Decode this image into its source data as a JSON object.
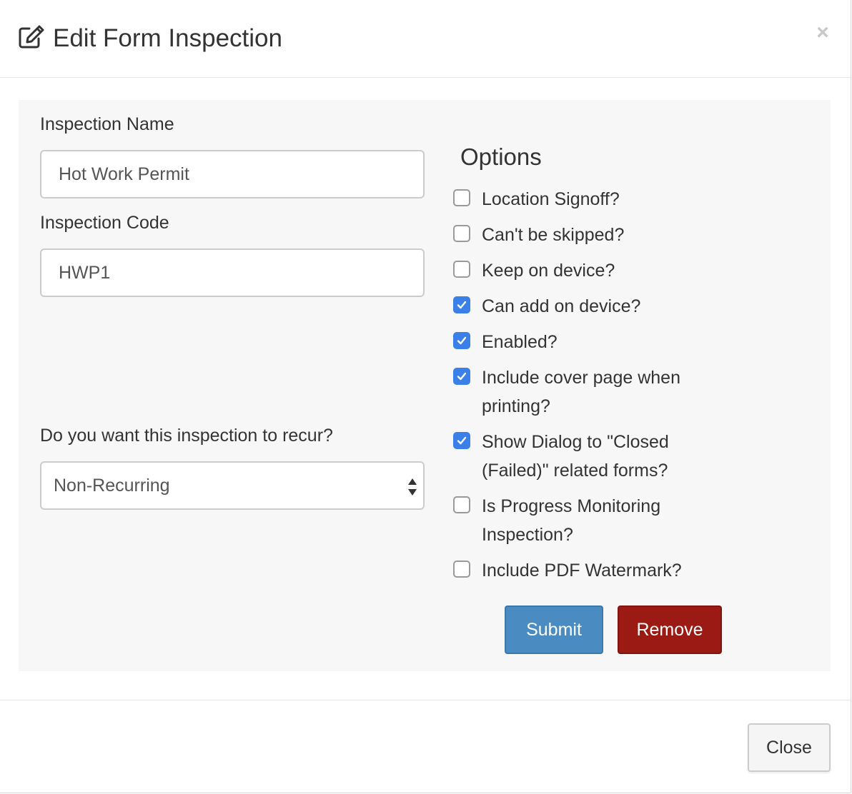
{
  "header": {
    "title": "Edit Form Inspection",
    "icon": "edit-icon",
    "close_glyph": "×"
  },
  "form": {
    "inspection_name": {
      "label": "Inspection Name",
      "value": "Hot Work Permit"
    },
    "inspection_code": {
      "label": "Inspection Code",
      "value": "HWP1"
    },
    "recurrence": {
      "label": "Do you want this inspection to recur?",
      "selected": "Non-Recurring"
    }
  },
  "options": {
    "heading": "Options",
    "items": [
      {
        "label": "Location Signoff?",
        "checked": false
      },
      {
        "label": "Can't be skipped?",
        "checked": false
      },
      {
        "label": "Keep on device?",
        "checked": false
      },
      {
        "label": "Can add on device?",
        "checked": true
      },
      {
        "label": "Enabled?",
        "checked": true
      },
      {
        "label": "Include cover page when printing?",
        "checked": true
      },
      {
        "label": "Show Dialog to \"Closed (Failed)\" related forms?",
        "checked": true
      },
      {
        "label": "Is Progress Monitoring Inspection?",
        "checked": false
      },
      {
        "label": "Include PDF Watermark?",
        "checked": false
      }
    ]
  },
  "actions": {
    "submit_label": "Submit",
    "remove_label": "Remove"
  },
  "footer": {
    "close_label": "Close"
  },
  "colors": {
    "checkbox_checked": "#3b80e8",
    "submit_button": "#4a8bc2",
    "remove_button": "#9b1b14",
    "panel_background": "#f7f7f7"
  }
}
